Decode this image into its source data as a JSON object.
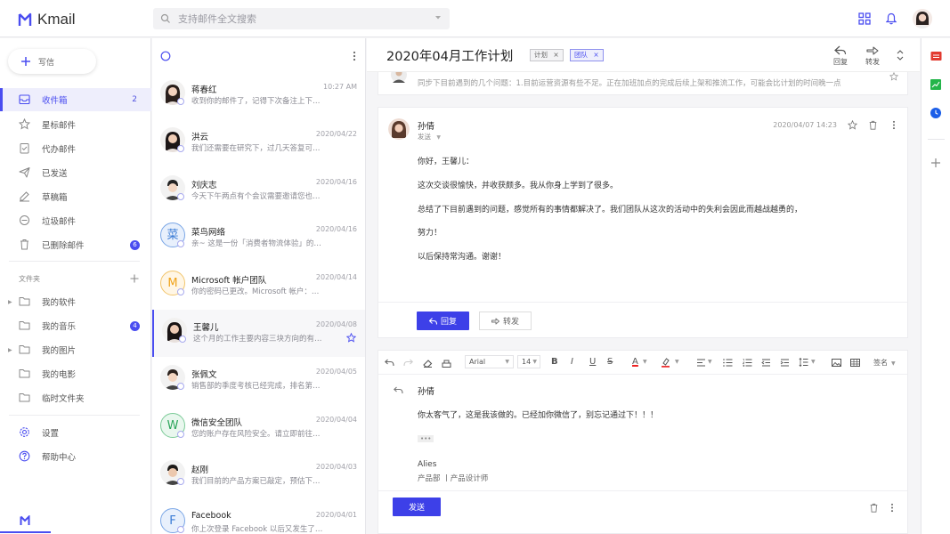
{
  "app": {
    "name": "Kmail"
  },
  "search": {
    "placeholder": "支持邮件全文搜索"
  },
  "colors": {
    "accent": "#4a4df0",
    "primary_button": "#3d40e8",
    "badge": "#4a4df0"
  },
  "sidebar": {
    "compose_label": "写信",
    "folders": [
      {
        "label": "收件箱",
        "count": "2",
        "icon": "inbox-icon"
      },
      {
        "label": "星标邮件",
        "icon": "star-icon"
      },
      {
        "label": "代办邮件",
        "icon": "todo-icon"
      },
      {
        "label": "已发送",
        "icon": "send-icon"
      },
      {
        "label": "草稿箱",
        "icon": "draft-icon"
      },
      {
        "label": "垃圾邮件",
        "icon": "spam-icon"
      },
      {
        "label": "已删除邮件",
        "badge": "6",
        "icon": "trash-icon"
      }
    ],
    "folder_section": "文件夹",
    "custom_folders": [
      {
        "label": "我的软件"
      },
      {
        "label": "我的音乐",
        "badge": "4"
      },
      {
        "label": "我的图片"
      },
      {
        "label": "我的电影"
      },
      {
        "label": "临时文件夹"
      }
    ],
    "settings": "设置",
    "help": "帮助中心"
  },
  "mail_list": [
    {
      "name": "蒋春红",
      "date": "10:27 AM",
      "snippet": "收到你的邮件了，记得下次备注上下订单号。",
      "avatar": "photo"
    },
    {
      "name": "洪云",
      "date": "2020/04/22",
      "snippet": "我们还需要在研究下，过几天答复可以吗？",
      "avatar": "photo"
    },
    {
      "name": "刘庆志",
      "date": "2020/04/16",
      "snippet": "今天下午两点有个会议需要邀请您也参加。",
      "avatar": "photo"
    },
    {
      "name": "菜鸟网络",
      "date": "2020/04/16",
      "snippet": "亲~ 这是一份「消费者物流体验」的调查问卷",
      "avatar_text": "菜"
    },
    {
      "name": "Microsoft 帐户团队",
      "date": "2020/04/14",
      "snippet": "你的密码已更改。Microsoft 帐户：请注意",
      "avatar_text": "M"
    },
    {
      "name": "王馨儿",
      "date": "2020/04/08",
      "snippet": "这个月的工作主要内容三块方向的有些改变",
      "avatar": "photo",
      "starred": true
    },
    {
      "name": "张佩文",
      "date": "2020/04/05",
      "snippet": "销售部的季度考核已经完成，排名第一的是",
      "avatar": "photo"
    },
    {
      "name": "微信安全团队",
      "date": "2020/04/04",
      "snippet": "您的账户存在风险安全。请立即前往处理",
      "avatar_text": "W"
    },
    {
      "name": "赵刚",
      "date": "2020/04/03",
      "snippet": "我们目前的产品方案已敲定，预估下周可以",
      "avatar": "photo"
    },
    {
      "name": "Facebook",
      "date": "2020/04/01",
      "snippet": "你上次登录 Facebook 以后又发生了很多事",
      "avatar_text": "F"
    }
  ],
  "thread": {
    "subject": "2020年04月工作计划",
    "tags": [
      "计划",
      "团队"
    ],
    "actions": {
      "reply": "回复",
      "forward": "转发"
    },
    "previous_snippet": "同步下目前遇到的几个问题：1.目前运营资源有些不足。正在加班加点的完成后续上架和推流工作，可能会比计划的时间晚一点"
  },
  "message": {
    "sender": "孙倩",
    "sent_label": "发送",
    "date": "2020/04/07 14:23",
    "body": [
      "你好，王馨儿：",
      "这次交谈很愉快，并收获颇多。我从你身上学到了很多。",
      "总结了下目前遇到的问题，感觉所有的事情都解决了。我们团队从这次的活动中的失利会因此而越战越勇的，",
      "努力！",
      "以后保持常沟通。谢谢！"
    ],
    "reply_button": "回复",
    "forward_button": "转发"
  },
  "composer": {
    "font": "Arial",
    "size": "14",
    "signature_label": "签名",
    "recipient": "孙倩",
    "body": "你太客气了，这是我该做的。已经加你微信了，别忘记通过下！！！",
    "ellipsis": "•••",
    "sig_name": "Alies",
    "sig_info": "产品部 丨产品设计师",
    "send_button": "发送"
  }
}
